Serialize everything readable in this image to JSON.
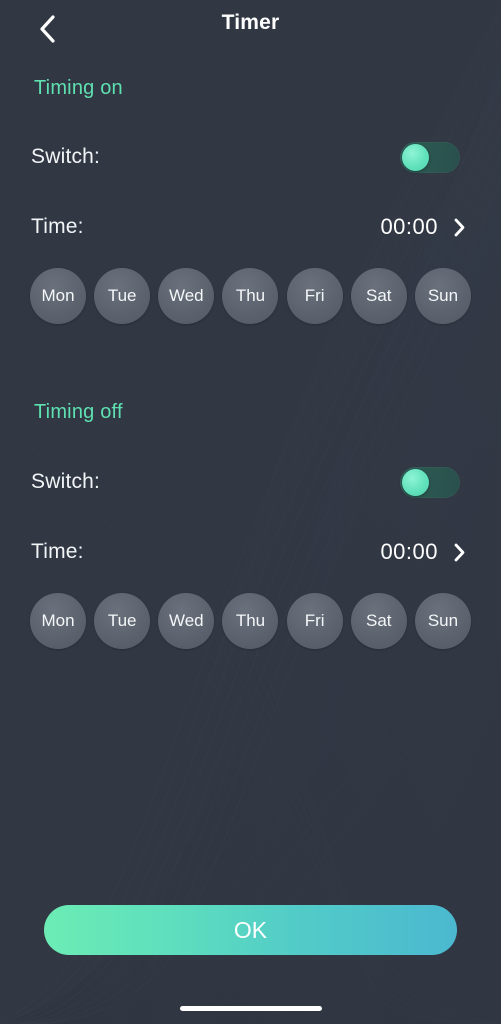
{
  "header": {
    "title": "Timer",
    "back_icon": "chevron-left-icon"
  },
  "sections": [
    {
      "title": "Timing on",
      "switch_label": "Switch:",
      "switch_state": "off",
      "time_label": "Time:",
      "time_value": "00:00",
      "time_chevron_icon": "chevron-right-icon",
      "days": [
        "Mon",
        "Tue",
        "Wed",
        "Thu",
        "Fri",
        "Sat",
        "Sun"
      ]
    },
    {
      "title": "Timing off",
      "switch_label": "Switch:",
      "switch_state": "off",
      "time_label": "Time:",
      "time_value": "00:00",
      "time_chevron_icon": "chevron-right-icon",
      "days": [
        "Mon",
        "Tue",
        "Wed",
        "Thu",
        "Fri",
        "Sat",
        "Sun"
      ]
    }
  ],
  "footer": {
    "ok_label": "OK"
  },
  "colors": {
    "background": "#313844",
    "accent_green": "#5ee0b0",
    "toggle_knob": "#62e2bc",
    "toggle_track": "#2d5a55",
    "day_chip": "#5c636e",
    "ok_gradient_start": "#6cecb4",
    "ok_gradient_end": "#4bb8d0",
    "text_primary": "#f2f4f6"
  }
}
